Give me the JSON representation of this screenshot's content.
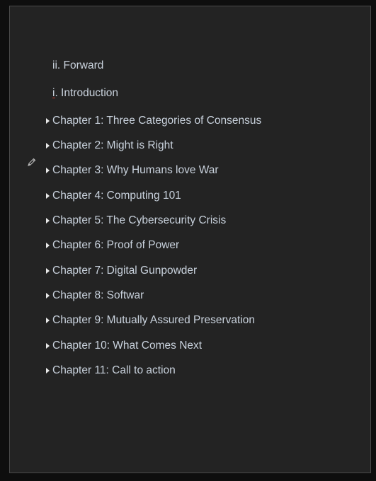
{
  "toc": {
    "front_matter": [
      {
        "label": "ii. Forward"
      },
      {
        "label": "i. Introduction"
      }
    ],
    "chapters": [
      {
        "label": "Chapter 1: Three Categories of Consensus"
      },
      {
        "label": "Chapter 2: Might is Right"
      },
      {
        "label": "Chapter 3: Why Humans love War"
      },
      {
        "label": "Chapter 4: Computing 101"
      },
      {
        "label": "Chapter 5: The Cybersecurity Crisis"
      },
      {
        "label": "Chapter 6: Proof of Power"
      },
      {
        "label": "Chapter 7: Digital Gunpowder"
      },
      {
        "label": "Chapter 8: Softwar"
      },
      {
        "label": "Chapter 9: Mutually Assured Preservation"
      },
      {
        "label": "Chapter 10: What Comes Next"
      },
      {
        "label": "Chapter 11: Call to action"
      }
    ]
  },
  "icons": {
    "pen": "pen-icon",
    "expand": "triangle-right-icon"
  },
  "colors": {
    "background": "#0e0e0e",
    "panel": "#232323",
    "text": "#c9d2dd"
  }
}
